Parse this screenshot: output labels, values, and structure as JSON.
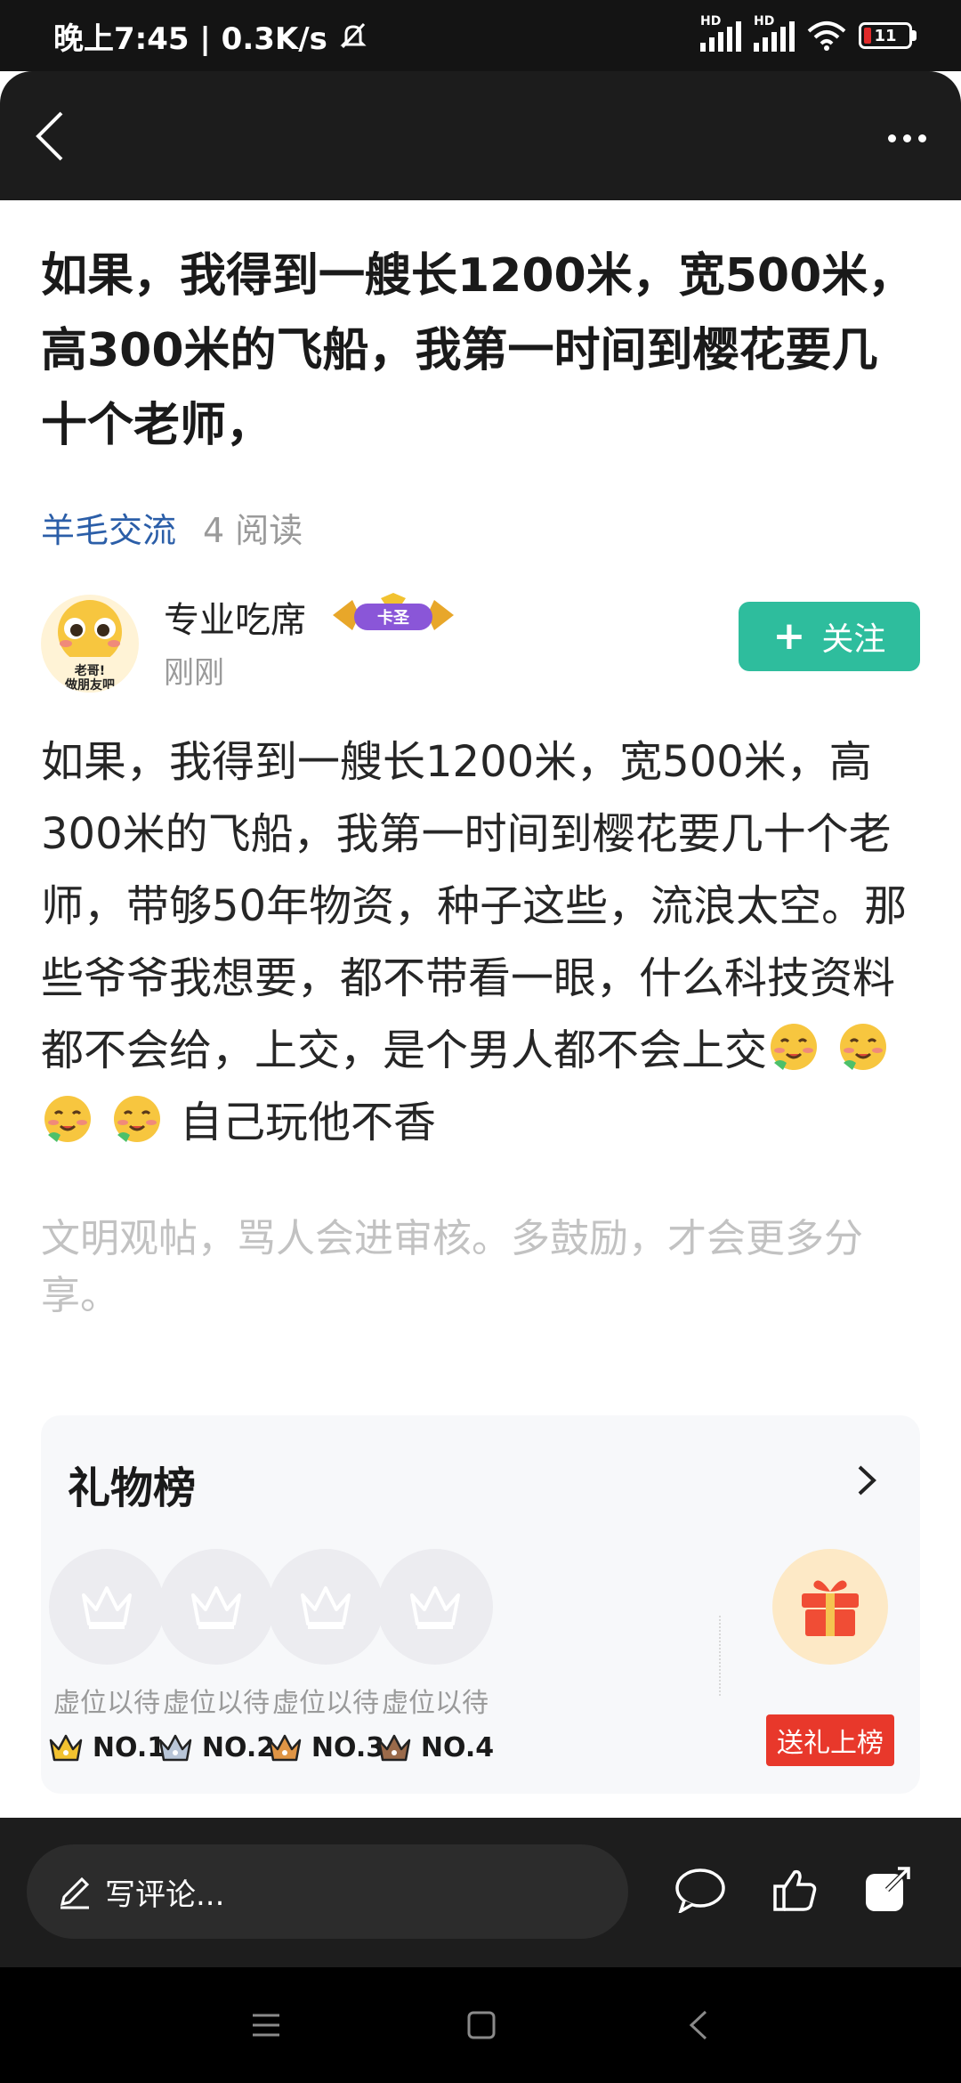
{
  "status_bar": {
    "time_speed": "晚上7:45 | 0.3K/s",
    "network_1": "HD",
    "network_2": "HD",
    "battery": "11",
    "icons": [
      "mute-icon",
      "signal-icon",
      "signal-icon",
      "wifi-icon",
      "battery-icon"
    ]
  },
  "header": {
    "icons": [
      "back-icon",
      "more-icon"
    ]
  },
  "post": {
    "title": "如果，我得到一艘长1200米，宽500米，高300米的飞船，我第一时间到樱花要几十个老师，",
    "group": "羊毛交流",
    "reads": "4 阅读",
    "body_text": "如果，我得到一艘长1200米，宽500米，高300米的飞船，我第一时间到樱花要几十个老师，带够50年物资，种子这些，流浪太空。那些爷爷我想要，都不带看一眼，什么科技资料都不会给，上交，是个男人都不会上交",
    "body_tail": "自己玩他不香",
    "emoji_count": 4,
    "notice": "文明观帖，骂人会进审核。多鼓励，才会更多分享。"
  },
  "author": {
    "name": "专业吃席",
    "badge": "卡圣",
    "time": "刚刚",
    "avatar_text_1": "老哥!",
    "avatar_text_2": "做朋友吧",
    "follow_label": "关注"
  },
  "gift_board": {
    "title": "礼物榜",
    "slots": [
      {
        "label": "虚位以待",
        "rank": "NO.1",
        "crown_color": "#f2c230"
      },
      {
        "label": "虚位以待",
        "rank": "NO.2",
        "crown_color": "#b9c6d8"
      },
      {
        "label": "虚位以待",
        "rank": "NO.3",
        "crown_color": "#e09545"
      },
      {
        "label": "虚位以待",
        "rank": "NO.4",
        "crown_color": "#9a6a4a"
      }
    ],
    "send_label": "送礼上榜"
  },
  "comment_bar": {
    "placeholder": "写评论...",
    "icons": [
      "pencil-icon",
      "comment-icon",
      "like-icon",
      "share-icon"
    ]
  },
  "nav": {
    "icons": [
      "menu-icon",
      "home-icon",
      "back-nav-icon"
    ]
  },
  "colors": {
    "follow": "#2ebd9d",
    "group_link": "#2b5ea8",
    "gift_button": "#e8382b",
    "dark_bar": "#1c1c1c"
  }
}
